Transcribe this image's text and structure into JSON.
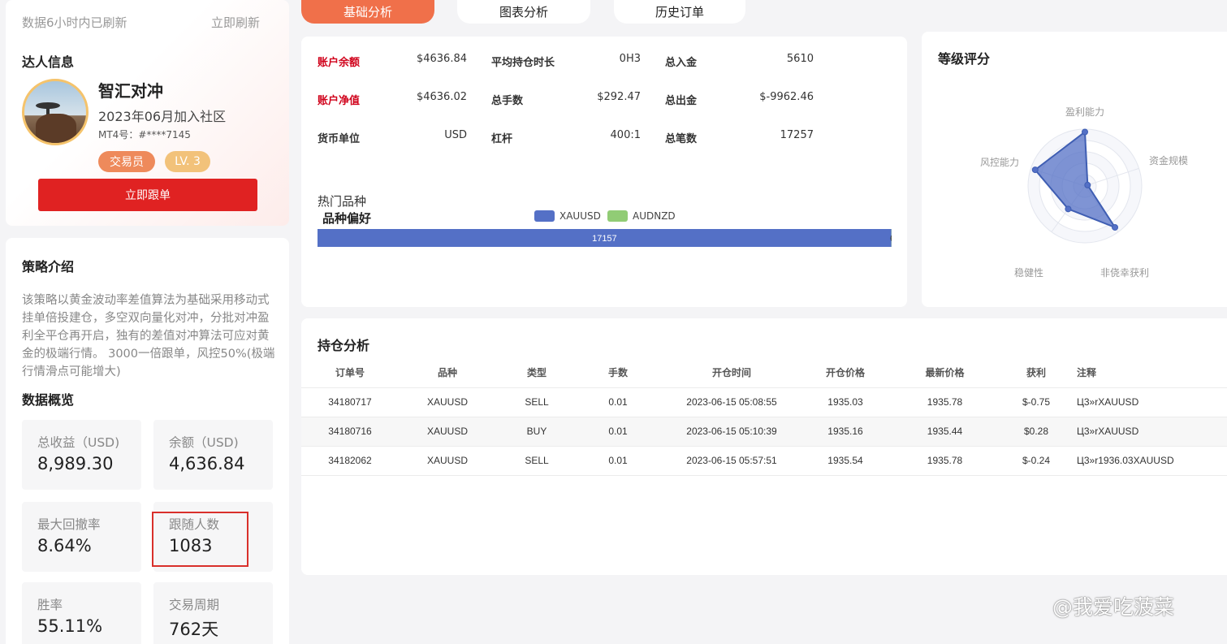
{
  "profile": {
    "refresh_note": "数据6小时内已刷新",
    "refresh_link": "立即刷新",
    "section_title": "达人信息",
    "name": "智汇对冲",
    "join_date": "2023年06月加入社区",
    "mt4": "MT4号：#****7145",
    "role_badge": "交易员",
    "level_badge": "LV. 3",
    "follow_button": "立即跟单"
  },
  "strategy": {
    "title": "策略介绍",
    "description": "该策略以黄金波动率差值算法为基础采用移动式挂单倍投建仓，多空双向量化对冲，分批对冲盈利全平仓再开启，独有的差值对冲算法可应对黄金的极端行情。 3000一倍跟单，风控50%(极端行情滑点可能增大)"
  },
  "overview": {
    "title": "数据概览",
    "stats": [
      {
        "label": "总收益（USD)",
        "value": "8,989.30"
      },
      {
        "label": "余额（USD)",
        "value": "4,636.84"
      },
      {
        "label": "最大回撤率",
        "value": "8.64%"
      },
      {
        "label": "跟随人数",
        "value": "1083"
      },
      {
        "label": "胜率",
        "value": "55.11%"
      },
      {
        "label": "交易周期",
        "value": "762天"
      }
    ]
  },
  "tabs": [
    "基础分析",
    "图表分析",
    "历史订单"
  ],
  "account": {
    "rows": [
      [
        {
          "label": "账户余额",
          "value": "$4636.84",
          "red": true
        },
        {
          "label": "平均持仓时长",
          "value": "0H3"
        },
        {
          "label": "总入金",
          "value": "5610"
        }
      ],
      [
        {
          "label": "账户净值",
          "value": "$4636.02",
          "red": true
        },
        {
          "label": "总手数",
          "value": "$292.47"
        },
        {
          "label": "总出金",
          "value": "$-9962.46"
        }
      ],
      [
        {
          "label": "货币单位",
          "value": "USD"
        },
        {
          "label": "杠杆",
          "value": "400:1"
        },
        {
          "label": "总笔数",
          "value": "17257"
        }
      ]
    ],
    "hot_title": "热门品种",
    "pref_title": "品种偏好"
  },
  "chart_data": {
    "type": "bar",
    "orientation": "horizontal",
    "stacked": true,
    "series": [
      {
        "name": "XAUUSD",
        "values": [
          17157
        ],
        "color": "#5470c6"
      },
      {
        "name": "AUDNZD",
        "values": [
          6
        ],
        "color": "#91cc75"
      }
    ],
    "data_labels": [
      "17157",
      "6"
    ],
    "legend": "top-center"
  },
  "rating": {
    "title": "等级评分",
    "chart_data": {
      "type": "radar",
      "indicators": [
        "盈利能力",
        "资金规模",
        "非侥幸获利",
        "稳健性",
        "风控能力"
      ],
      "values": [
        0.95,
        0.05,
        0.9,
        0.5,
        0.92
      ],
      "color": "#5470c6"
    }
  },
  "positions": {
    "title": "持仓分析",
    "columns": [
      "订单号",
      "品种",
      "类型",
      "手数",
      "开仓时间",
      "开仓价格",
      "最新价格",
      "获利",
      "注释"
    ],
    "rows": [
      [
        "34180717",
        "XAUUSD",
        "SELL",
        "0.01",
        "2023-06-15 05:08:55",
        "1935.03",
        "1935.78",
        "$-0.75",
        "Ц3»rXAUUSD"
      ],
      [
        "34180716",
        "XAUUSD",
        "BUY",
        "0.01",
        "2023-06-15 05:10:39",
        "1935.16",
        "1935.44",
        "$0.28",
        "Ц3»rXAUUSD"
      ],
      [
        "34182062",
        "XAUUSD",
        "SELL",
        "0.01",
        "2023-06-15 05:57:51",
        "1935.54",
        "1935.78",
        "$-0.24",
        "Ц3»r1936.03XAUUSD"
      ]
    ],
    "profit_colors": {
      "negative": "#e01b1b",
      "positive": "#3cc45c"
    }
  },
  "watermark": "@我爱吃菠菜"
}
